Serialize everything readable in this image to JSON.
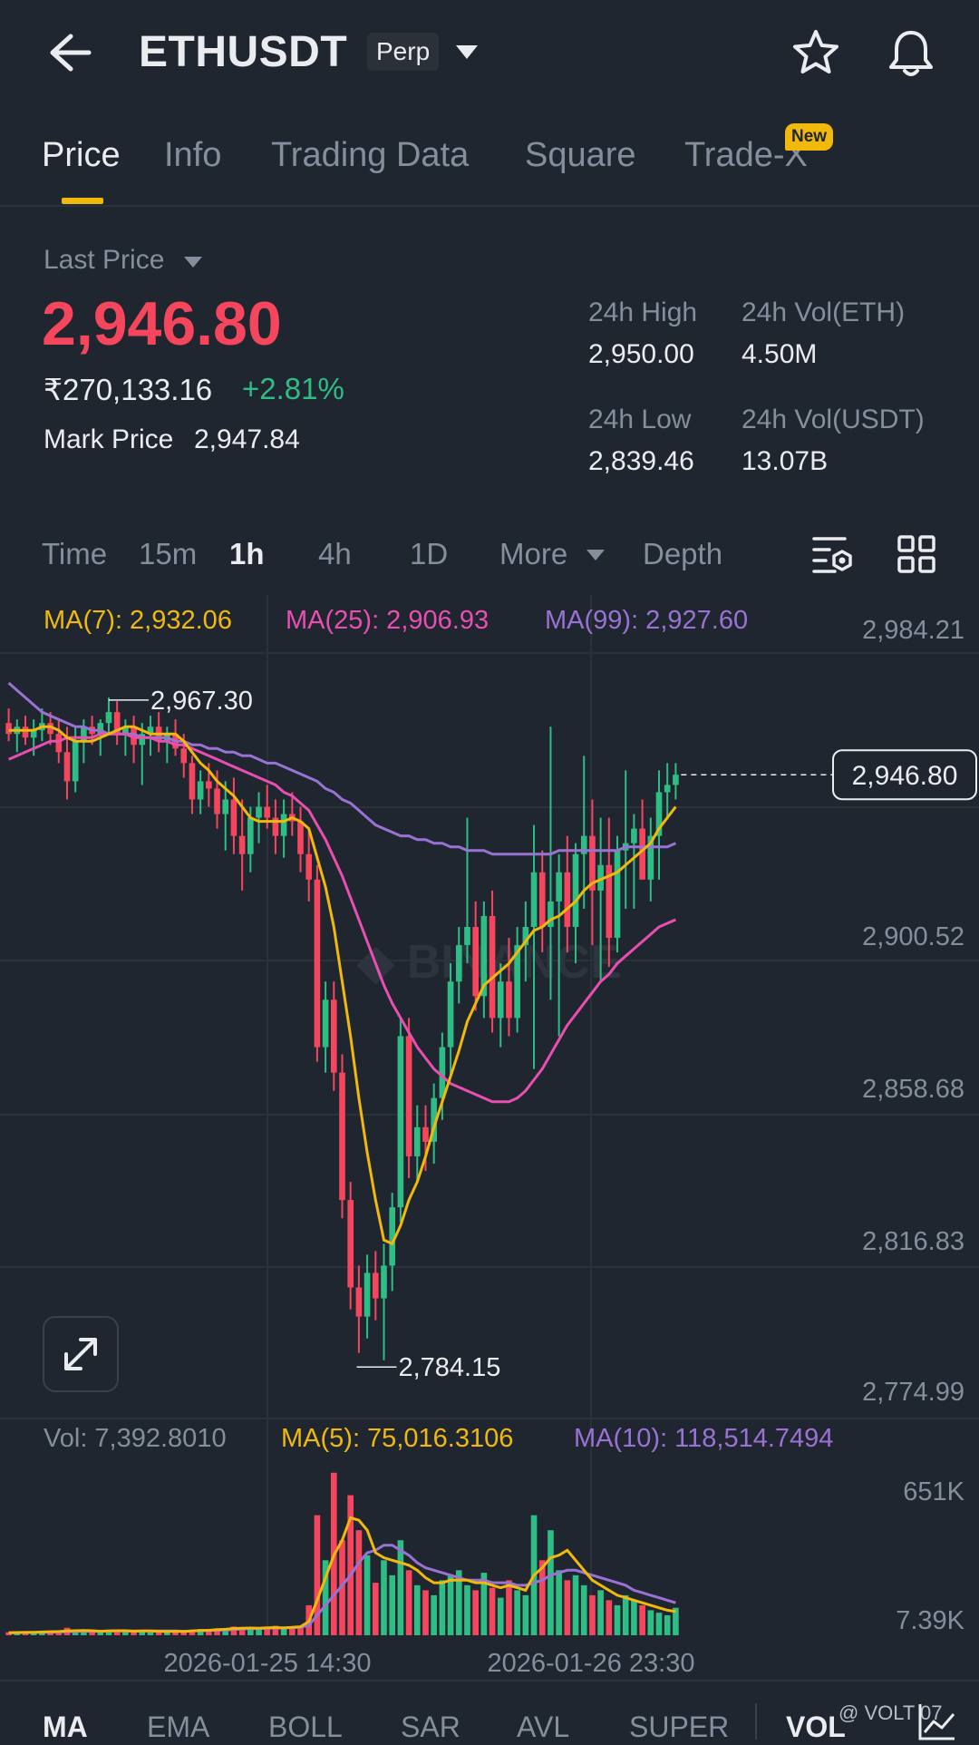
{
  "header": {
    "symbol": "ETHUSDT",
    "contract_type": "Perp"
  },
  "tabs": [
    {
      "label": "Price",
      "active": true
    },
    {
      "label": "Info"
    },
    {
      "label": "Trading Data"
    },
    {
      "label": "Square"
    },
    {
      "label": "Trade-X",
      "badge": "New"
    }
  ],
  "price": {
    "last_price_label": "Last Price",
    "last_price": "2,946.80",
    "inr_value": "₹270,133.16",
    "change_pct": "+2.81%",
    "mark_price_label": "Mark Price",
    "mark_price": "2,947.84"
  },
  "stats": {
    "high_label": "24h High",
    "high": "2,950.00",
    "vol_eth_label": "24h Vol(ETH)",
    "vol_eth": "4.50M",
    "low_label": "24h Low",
    "low": "2,839.46",
    "vol_usdt_label": "24h Vol(USDT)",
    "vol_usdt": "13.07B"
  },
  "intervals": {
    "time": "Time",
    "m15": "15m",
    "h1": "1h",
    "h4": "4h",
    "d1": "1D",
    "more": "More",
    "depth": "Depth",
    "active": "1h"
  },
  "ma_legend": {
    "ma7": "MA(7): 2,932.06",
    "ma25": "MA(25): 2,906.93",
    "ma99": "MA(99): 2,927.60"
  },
  "vol_legend": {
    "vol": "Vol: 7,392.8010",
    "ma5": "MA(5): 75,016.3106",
    "ma10": "MA(10): 118,514.7494"
  },
  "indicators": [
    "MA",
    "EMA",
    "BOLL",
    "SAR",
    "AVL",
    "SUPER",
    "VOL"
  ],
  "watermark": "@ VOLT 07",
  "colors": {
    "up": "#2ebd85",
    "down": "#f6465d",
    "accent": "#f0b90b",
    "ma7": "#f0b90b",
    "ma25": "#e84fb0",
    "ma99": "#9a72d4",
    "bg": "#202630",
    "grid": "#2b3139"
  },
  "chart_data": {
    "type": "candlestick",
    "interval": "1h",
    "y_axis_ticks": [
      "2,984.21",
      "2,900.52",
      "2,858.68",
      "2,816.83",
      "2,774.99"
    ],
    "ylim": [
      2774.99,
      2984.21
    ],
    "last_price": 2946.8,
    "last_price_label": "2,946.80",
    "high_marker": {
      "value": 2967.3,
      "label": "2,967.30"
    },
    "low_marker": {
      "value": 2784.15,
      "label": "2,784.15"
    },
    "x_tick_labels": [
      "2026-01-25 14:30",
      "2026-01-26 23:30"
    ],
    "volume_axis_ticks": [
      "651K",
      "7.39K"
    ],
    "volume_ylim": [
      0,
      700
    ],
    "candles": [
      [
        2961,
        2965,
        2956,
        2958
      ],
      [
        2958,
        2962,
        2953,
        2960
      ],
      [
        2960,
        2963,
        2955,
        2957
      ],
      [
        2957,
        2962,
        2952,
        2959
      ],
      [
        2959,
        2965,
        2956,
        2961
      ],
      [
        2961,
        2964,
        2955,
        2958
      ],
      [
        2958,
        2962,
        2950,
        2953
      ],
      [
        2953,
        2960,
        2940,
        2945
      ],
      [
        2945,
        2960,
        2942,
        2956
      ],
      [
        2956,
        2962,
        2950,
        2960
      ],
      [
        2960,
        2963,
        2955,
        2958
      ],
      [
        2958,
        2962,
        2952,
        2961
      ],
      [
        2961,
        2968,
        2958,
        2964
      ],
      [
        2964,
        2967,
        2955,
        2958
      ],
      [
        2958,
        2962,
        2952,
        2960
      ],
      [
        2960,
        2963,
        2950,
        2955
      ],
      [
        2955,
        2961,
        2944,
        2958
      ],
      [
        2958,
        2963,
        2952,
        2960
      ],
      [
        2960,
        2964,
        2953,
        2956
      ],
      [
        2956,
        2960,
        2950,
        2958
      ],
      [
        2958,
        2962,
        2952,
        2954
      ],
      [
        2954,
        2958,
        2946,
        2950
      ],
      [
        2950,
        2952,
        2936,
        2940
      ],
      [
        2940,
        2948,
        2936,
        2945
      ],
      [
        2945,
        2950,
        2938,
        2943
      ],
      [
        2943,
        2948,
        2932,
        2936
      ],
      [
        2936,
        2945,
        2926,
        2940
      ],
      [
        2940,
        2946,
        2925,
        2930
      ],
      [
        2930,
        2940,
        2915,
        2925
      ],
      [
        2925,
        2938,
        2920,
        2935
      ],
      [
        2935,
        2942,
        2928,
        2938
      ],
      [
        2938,
        2944,
        2932,
        2935
      ],
      [
        2935,
        2940,
        2925,
        2930
      ],
      [
        2930,
        2940,
        2924,
        2936
      ],
      [
        2936,
        2942,
        2930,
        2934
      ],
      [
        2934,
        2938,
        2920,
        2925
      ],
      [
        2925,
        2932,
        2912,
        2918
      ],
      [
        2918,
        2922,
        2868,
        2872
      ],
      [
        2872,
        2890,
        2865,
        2885
      ],
      [
        2885,
        2890,
        2860,
        2865
      ],
      [
        2865,
        2870,
        2825,
        2830
      ],
      [
        2830,
        2835,
        2800,
        2806
      ],
      [
        2806,
        2812,
        2788,
        2798
      ],
      [
        2798,
        2815,
        2792,
        2810
      ],
      [
        2810,
        2816,
        2797,
        2803
      ],
      [
        2803,
        2818,
        2786,
        2812
      ],
      [
        2812,
        2832,
        2805,
        2828
      ],
      [
        2828,
        2880,
        2824,
        2875
      ],
      [
        2875,
        2880,
        2836,
        2842
      ],
      [
        2842,
        2856,
        2835,
        2850
      ],
      [
        2850,
        2856,
        2838,
        2846
      ],
      [
        2846,
        2862,
        2840,
        2858
      ],
      [
        2858,
        2876,
        2852,
        2872
      ],
      [
        2872,
        2895,
        2864,
        2890
      ],
      [
        2890,
        2905,
        2884,
        2900
      ],
      [
        2900,
        2935,
        2895,
        2905
      ],
      [
        2905,
        2912,
        2882,
        2886
      ],
      [
        2886,
        2912,
        2880,
        2908
      ],
      [
        2908,
        2915,
        2876,
        2880
      ],
      [
        2880,
        2895,
        2872,
        2890
      ],
      [
        2890,
        2902,
        2875,
        2880
      ],
      [
        2880,
        2905,
        2876,
        2900
      ],
      [
        2900,
        2912,
        2890,
        2905
      ],
      [
        2905,
        2933,
        2866,
        2920
      ],
      [
        2920,
        2926,
        2898,
        2905
      ],
      [
        2905,
        2960,
        2885,
        2912
      ],
      [
        2912,
        2925,
        2875,
        2920
      ],
      [
        2920,
        2930,
        2898,
        2905
      ],
      [
        2905,
        2928,
        2895,
        2925
      ],
      [
        2925,
        2952,
        2910,
        2930
      ],
      [
        2930,
        2940,
        2900,
        2915
      ],
      [
        2915,
        2935,
        2890,
        2922
      ],
      [
        2922,
        2935,
        2894,
        2902
      ],
      [
        2902,
        2930,
        2898,
        2926
      ],
      [
        2926,
        2948,
        2910,
        2928
      ],
      [
        2928,
        2936,
        2910,
        2932
      ],
      [
        2932,
        2940,
        2920,
        2918
      ],
      [
        2918,
        2935,
        2912,
        2930
      ],
      [
        2930,
        2948,
        2918,
        2942
      ],
      [
        2942,
        2950,
        2935,
        2944
      ],
      [
        2944,
        2950,
        2940,
        2946.8
      ]
    ],
    "volume": [
      12,
      10,
      14,
      9,
      11,
      15,
      13,
      30,
      18,
      14,
      12,
      16,
      22,
      18,
      14,
      12,
      20,
      15,
      13,
      11,
      16,
      14,
      22,
      25,
      20,
      28,
      24,
      35,
      26,
      30,
      22,
      32,
      38,
      24,
      28,
      36,
      120,
      480,
      300,
      650,
      380,
      560,
      420,
      320,
      210,
      300,
      240,
      380,
      260,
      200,
      180,
      160,
      220,
      240,
      260,
      200,
      180,
      250,
      190,
      150,
      220,
      180,
      160,
      480,
      300,
      420,
      260,
      220,
      240,
      200,
      160,
      180,
      140,
      120,
      160,
      140,
      120,
      100,
      90,
      80,
      110
    ],
    "ma7": [
      2959,
      2959,
      2959,
      2959,
      2960,
      2960,
      2959,
      2957,
      2956,
      2956,
      2956,
      2957,
      2958,
      2959,
      2960,
      2960,
      2959,
      2958,
      2958,
      2958,
      2958,
      2956,
      2953,
      2950,
      2948,
      2945,
      2943,
      2941,
      2938,
      2935,
      2934,
      2934,
      2934,
      2934,
      2935,
      2934,
      2932,
      2924,
      2916,
      2905,
      2890,
      2875,
      2858,
      2843,
      2830,
      2819,
      2818,
      2823,
      2830,
      2835,
      2842,
      2850,
      2857,
      2864,
      2871,
      2879,
      2884,
      2889,
      2891,
      2893,
      2895,
      2898,
      2901,
      2904,
      2905,
      2907,
      2908,
      2910,
      2912,
      2915,
      2917,
      2918,
      2919,
      2920,
      2922,
      2924,
      2926,
      2928,
      2932,
      2935,
      2938
    ],
    "ma25": [
      2951,
      2952,
      2953,
      2954,
      2955,
      2956,
      2956,
      2957,
      2957,
      2957,
      2957,
      2958,
      2958,
      2958,
      2958,
      2957,
      2957,
      2957,
      2956,
      2956,
      2955,
      2955,
      2954,
      2953,
      2952,
      2951,
      2950,
      2949,
      2948,
      2947,
      2946,
      2945,
      2944,
      2942,
      2941,
      2939,
      2937,
      2933,
      2929,
      2924,
      2919,
      2913,
      2907,
      2901,
      2895,
      2889,
      2884,
      2880,
      2876,
      2872,
      2869,
      2866,
      2864,
      2862,
      2861,
      2860,
      2859,
      2858,
      2857,
      2857,
      2857,
      2858,
      2860,
      2863,
      2866,
      2870,
      2874,
      2878,
      2881,
      2884,
      2887,
      2890,
      2892,
      2895,
      2897,
      2899,
      2901,
      2903,
      2905,
      2906,
      2907
    ],
    "ma99": [
      2972,
      2970,
      2968,
      2966,
      2964,
      2963,
      2962,
      2961,
      2960,
      2960,
      2959,
      2959,
      2958,
      2958,
      2958,
      2958,
      2957,
      2957,
      2957,
      2957,
      2956,
      2956,
      2955,
      2955,
      2954,
      2954,
      2953,
      2953,
      2952,
      2952,
      2951,
      2950,
      2950,
      2949,
      2948,
      2947,
      2946,
      2945,
      2943,
      2942,
      2940,
      2939,
      2937,
      2935,
      2933,
      2932,
      2931,
      2930,
      2930,
      2929,
      2929,
      2928,
      2928,
      2927,
      2927,
      2926,
      2926,
      2926,
      2925,
      2925,
      2925,
      2925,
      2925,
      2925,
      2925,
      2925,
      2926,
      2926,
      2926,
      2926,
      2926,
      2926,
      2926,
      2926,
      2927,
      2927,
      2927,
      2927,
      2927,
      2927,
      2928
    ],
    "vol_ma5": [
      10,
      11,
      12,
      12,
      13,
      14,
      15,
      17,
      18,
      19,
      18,
      16,
      17,
      18,
      18,
      16,
      17,
      17,
      16,
      15,
      16,
      15,
      17,
      19,
      20,
      22,
      24,
      27,
      28,
      29,
      28,
      30,
      31,
      29,
      32,
      34,
      55,
      140,
      230,
      320,
      380,
      470,
      460,
      420,
      330,
      310,
      300,
      290,
      280,
      260,
      230,
      210,
      210,
      220,
      220,
      220,
      210,
      210,
      200,
      190,
      200,
      190,
      180,
      240,
      270,
      310,
      320,
      340,
      300,
      260,
      220,
      200,
      180,
      160,
      150,
      140,
      130,
      120,
      110,
      100,
      95
    ],
    "vol_ma10": [
      10,
      10,
      11,
      11,
      12,
      12,
      13,
      14,
      15,
      16,
      16,
      16,
      17,
      17,
      17,
      17,
      17,
      17,
      17,
      17,
      17,
      16,
      17,
      18,
      19,
      20,
      21,
      23,
      25,
      26,
      27,
      28,
      29,
      30,
      31,
      32,
      40,
      80,
      120,
      160,
      200,
      240,
      290,
      330,
      340,
      360,
      360,
      340,
      320,
      290,
      270,
      260,
      250,
      240,
      230,
      220,
      220,
      220,
      210,
      210,
      210,
      200,
      200,
      210,
      220,
      240,
      250,
      260,
      260,
      250,
      240,
      230,
      220,
      210,
      200,
      180,
      170,
      160,
      150,
      140,
      130
    ]
  }
}
